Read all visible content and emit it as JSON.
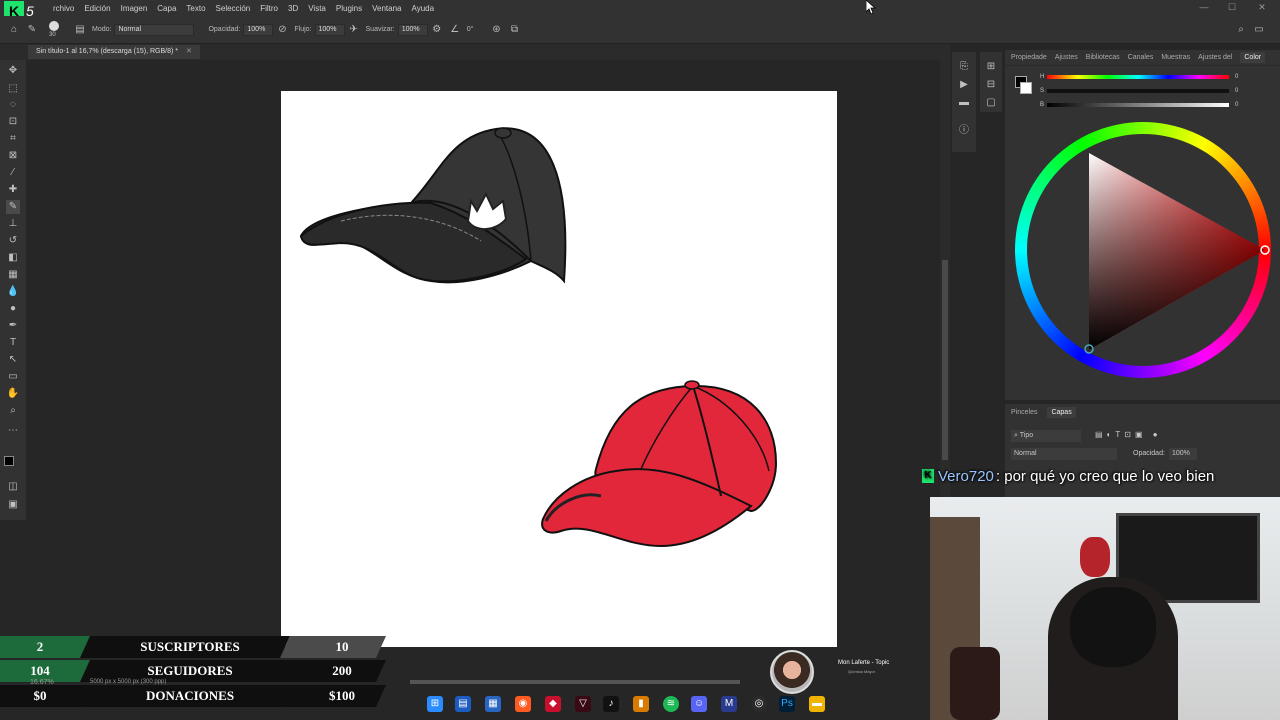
{
  "menu": {
    "items": [
      "rchivo",
      "Edición",
      "Imagen",
      "Capa",
      "Texto",
      "Selección",
      "Filtro",
      "3D",
      "Vista",
      "Plugins",
      "Ventana",
      "Ayuda"
    ]
  },
  "options": {
    "brush_size": "30",
    "mode_label": "Modo:",
    "mode_value": "Normal",
    "opacity_label": "Opacidad:",
    "opacity_value": "100%",
    "flow_label": "Flujo:",
    "flow_value": "100%",
    "smooth_label": "Suavizar:",
    "smooth_value": "100%",
    "angle_value": "0°"
  },
  "document": {
    "tab_title": "Sin título-1 al 16,7% (descarga (15), RGB/8) *",
    "zoom": "16.67%",
    "size_info": "5000 px x 5000 px (300 ppp)"
  },
  "color_panel": {
    "tabs": [
      "Propiedade",
      "Ajustes",
      "Bibliotecas",
      "Canales",
      "Muestras",
      "Ajustes del",
      "Color"
    ],
    "active_tab": "Color",
    "sliders": [
      {
        "name": "H",
        "value": "0"
      },
      {
        "name": "S",
        "value": "0"
      },
      {
        "name": "B",
        "value": "0"
      }
    ]
  },
  "layers_panel": {
    "tabs": [
      "Pinceles",
      "Capas"
    ],
    "active_tab": "Capas",
    "filter_label": "Tipo",
    "blend_mode": "Normal",
    "opacity_label": "Opacidad:",
    "opacity_value": "100%"
  },
  "chat": {
    "badge": "K",
    "user": "Vero720",
    "message": ": por qué yo creo que lo veo bien"
  },
  "stats": [
    {
      "count": "2",
      "label": "SUSCRIPTORES",
      "goal": "10",
      "color": "#1d6b3a"
    },
    {
      "count": "104",
      "label": "SEGUIDORES",
      "goal": "200",
      "color": "#1d6b3a"
    },
    {
      "count": "$0",
      "label": "DONACIONES",
      "goal": "$100",
      "color": "#1d6b3a"
    }
  ],
  "music": {
    "title": "Mon Laferte - Topic",
    "artist": "Química Mayor"
  },
  "taskbar_icons": [
    "windows-icon",
    "files-icon",
    "calendar-icon",
    "browser-icon",
    "app-red-icon",
    "app-dark-icon",
    "tiktok-icon",
    "app-orange-icon",
    "spotify-icon",
    "discord-icon",
    "app-blue-icon",
    "chrome-icon",
    "photoshop-icon",
    "folder-icon"
  ],
  "colors": {
    "cap_dark": "#353535",
    "cap_red": "#e3273a",
    "stat_green": "#1d6b3a"
  }
}
